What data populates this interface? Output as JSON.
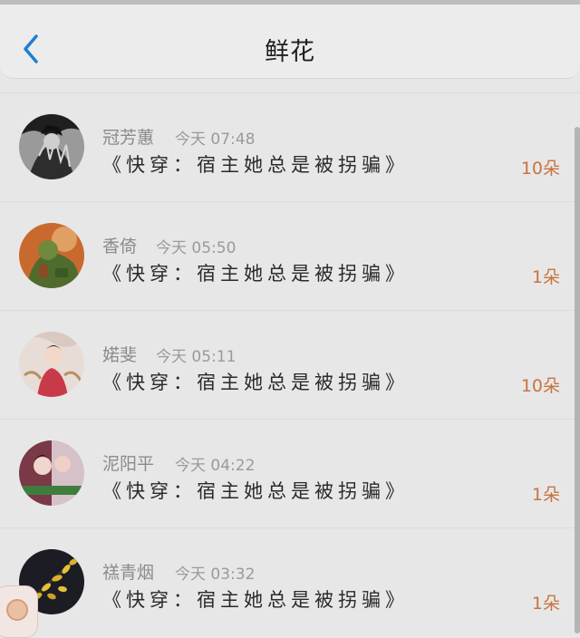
{
  "header": {
    "title": "鲜花",
    "back_icon": "chevron-left-icon"
  },
  "colors": {
    "accent": "#1e7fd0",
    "count": "#c8743e",
    "name": "#8b8b8b",
    "background": "#e7e7e7"
  },
  "items": [
    {
      "name": "冠芳蕙",
      "time": "今天 07:48",
      "book": "《快穿：宿主她总是被拐骗》",
      "count": "10朵"
    },
    {
      "name": "香倚",
      "time": "今天 05:50",
      "book": "《快穿：宿主她总是被拐骗》",
      "count": "1朵"
    },
    {
      "name": "婼斐",
      "time": "今天 05:11",
      "book": "《快穿：宿主她总是被拐骗》",
      "count": "10朵"
    },
    {
      "name": "泥阳平",
      "time": "今天 04:22",
      "book": "《快穿：宿主她总是被拐骗》",
      "count": "1朵"
    },
    {
      "name": "禚青烟",
      "time": "今天 03:32",
      "book": "《快穿：宿主她总是被拐骗》",
      "count": "1朵"
    }
  ]
}
